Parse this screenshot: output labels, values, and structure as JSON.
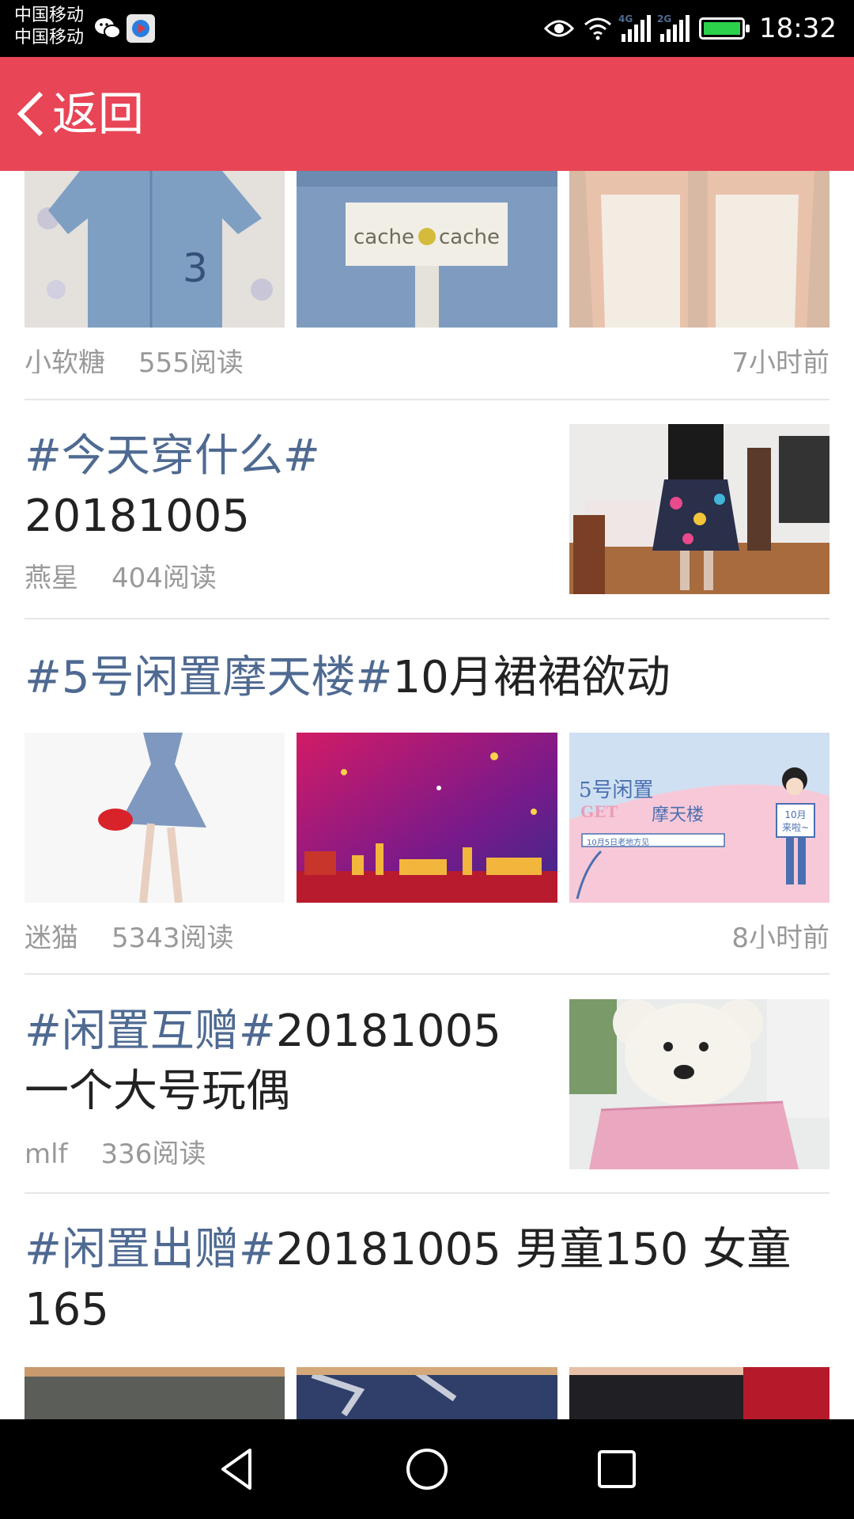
{
  "status_bar": {
    "carrier_1": "中国移动",
    "carrier_2": "中国移动",
    "network_1": "4G",
    "network_2": "2G",
    "time": "18:32"
  },
  "header": {
    "back_label": "返回",
    "background_color": "#e84556"
  },
  "feed": {
    "tag_color": "#4f6a92",
    "posts": [
      {
        "author": "小软糖",
        "reads": "555阅读",
        "time": "7小时前",
        "images": [
          "denim-dress-photo",
          "cache-cache-label-photo",
          "pink-shoes-photo"
        ]
      },
      {
        "title_tag": "#今天穿什么#",
        "title_rest": "20181005",
        "author": "燕星",
        "reads": "404阅读",
        "images": [
          "floral-skirt-photo"
        ]
      },
      {
        "title_tag": "#5号闲置摩天楼#",
        "title_rest": "10月裙裙欲动",
        "author": "迷猫",
        "reads": "5343阅读",
        "time": "8小时前",
        "images": [
          "girl-blue-skirt-photo",
          "red-city-poster",
          "swap-event-poster"
        ],
        "poster_text": {
          "line1": "5号闲置",
          "line2": "GET",
          "line3": "摩天楼",
          "search_text": "10月5日老地方见",
          "sign_1": "10月",
          "sign_2": "来啦~"
        }
      },
      {
        "title_tag": "#闲置互赠#",
        "title_rest_1": "20181005",
        "title_rest_2": "一个大号玩偶",
        "author": "mlf",
        "reads": "336阅读",
        "images": [
          "teddy-bear-photo"
        ]
      },
      {
        "title_tag": "#闲置出赠#",
        "title_rest_1": "20181005 男童150 女童",
        "title_rest_2": "165",
        "images": [
          "dark-clothes-photo",
          "jeans-photo",
          "black-red-clothes-photo"
        ]
      }
    ]
  }
}
